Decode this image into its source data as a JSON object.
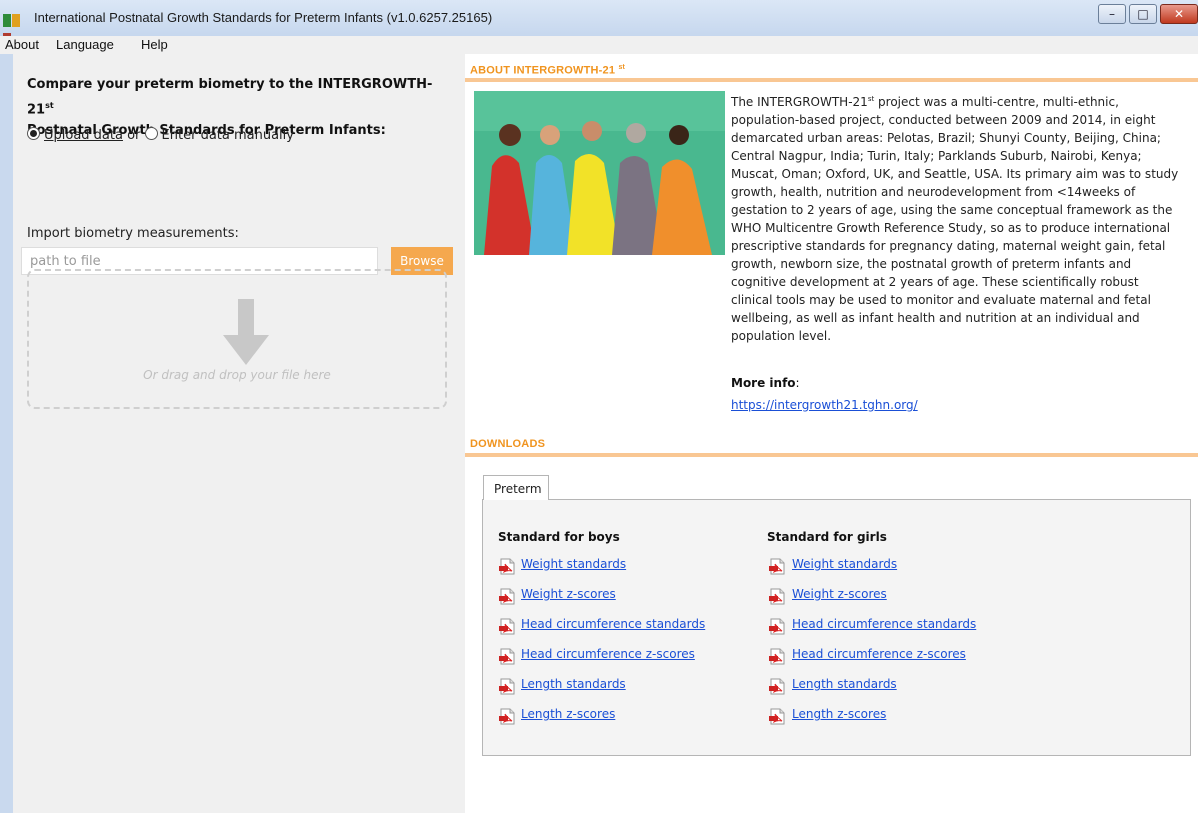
{
  "window": {
    "title": "International Postnatal Growth Standards for Preterm Infants (v1.0.6257.25165)"
  },
  "menu": [
    "About",
    "Language",
    "Help"
  ],
  "left_panel": {
    "title_line1": "Compare your preterm biometry to the INTERGROWTH-21",
    "title_sup": "st",
    "title_line2": "Postnatal Growth Standards for Preterm Infants:",
    "radio_upload": "Upload data",
    "radio_or": " or ",
    "radio_manual": "Enter data manually",
    "import_label": "Import biometry measurements:",
    "path_placeholder": "path to file",
    "browse_label": "Browse",
    "drop_text": "Or drag and drop your file here"
  },
  "about": {
    "heading": "ABOUT INTERGROWTH-21",
    "heading_sup": "st",
    "line1_pre": "The INTERGROWTH-21",
    "line1_sup": "st",
    "line1_post": " project was a multi-centre, multi-ethnic,",
    "lines": [
      "population-based project, conducted between 2009 and 2014, in eight",
      "demarcated urban areas: Pelotas, Brazil; Shunyi County, Beijing, China;",
      "Central Nagpur, India; Turin, Italy; Parklands Suburb, Nairobi, Kenya;",
      "Muscat, Oman; Oxford, UK, and Seattle, USA.  Its primary aim was to study",
      "growth, health, nutrition and neurodevelopment from <14weeks of",
      "gestation to 2 years of age, using the same conceptual framework as the",
      "WHO Multicentre Growth Reference Study, so as to produce international",
      "prescriptive standards for pregnancy dating, maternal weight gain, fetal",
      "growth, newborn size, the postnatal growth of preterm infants and",
      "cognitive development at 2 years of age.  These scientifically robust",
      "clinical tools may be used to monitor and evaluate maternal and fetal",
      "wellbeing, as well as infant health and nutrition at an individual and",
      "population level."
    ],
    "more_info_label": "More info",
    "more_info_colon": ":",
    "more_info_link": "https://intergrowth21.tghn.org/"
  },
  "downloads": {
    "heading": "DOWNLOADS",
    "tab_label": "Preterm",
    "boys_heading": "Standard for boys",
    "girls_heading": "Standard for girls",
    "boys_links": [
      "Weight standards",
      "Weight z-scores",
      "Head circumference standards",
      "Head circumference z-scores",
      "Length standards",
      "Length z-scores"
    ],
    "girls_links": [
      "Weight standards",
      "Weight z-scores",
      "Head circumference standards",
      "Head circumference z-scores",
      "Length standards",
      "Length z-scores"
    ]
  },
  "colors": {
    "accent_orange": "#f0941f",
    "browse_orange": "#f5a84e",
    "link_blue": "#1a4fd6"
  }
}
